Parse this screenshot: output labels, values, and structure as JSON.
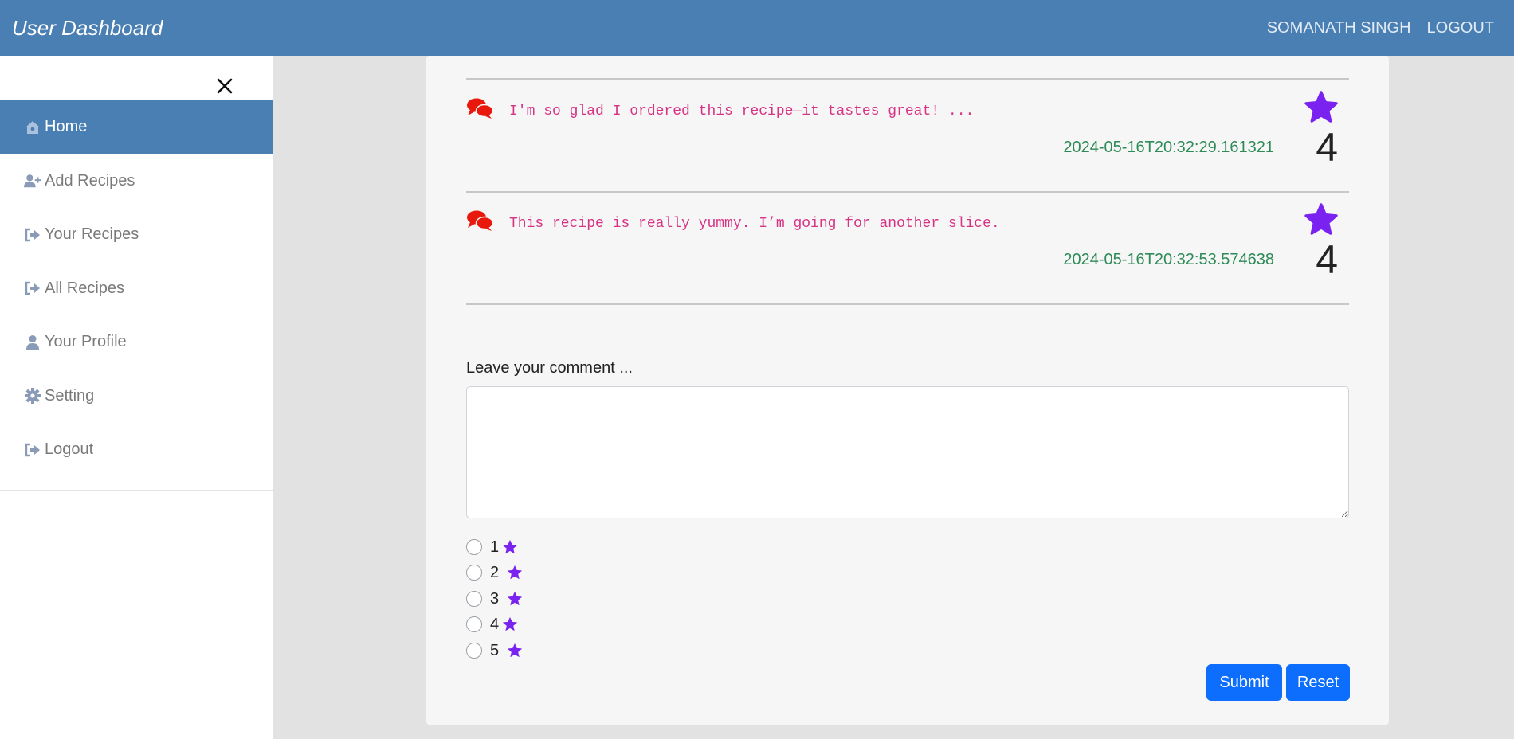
{
  "header": {
    "title": "User Dashboard",
    "user_name": "SOMANATH SINGH",
    "logout_label": "LOGOUT"
  },
  "sidebar": {
    "items": [
      {
        "label": "Home",
        "icon": "home-icon",
        "active": true
      },
      {
        "label": "Add Recipes",
        "icon": "add-user-icon",
        "active": false
      },
      {
        "label": "Your Recipes",
        "icon": "sign-out-icon",
        "active": false
      },
      {
        "label": "All Recipes",
        "icon": "sign-out-icon",
        "active": false
      },
      {
        "label": "Your Profile",
        "icon": "user-icon",
        "active": false
      },
      {
        "label": "Setting",
        "icon": "gear-icon",
        "active": false
      },
      {
        "label": "Logout",
        "icon": "sign-out-icon",
        "active": false
      }
    ]
  },
  "comments": [
    {
      "text": "I'm so glad I ordered this recipe—it tastes great! ...",
      "timestamp": "2024-05-16T20:32:29.161321",
      "rating": "4"
    },
    {
      "text": "This recipe is really yummy. I’m going for another slice.",
      "timestamp": "2024-05-16T20:32:53.574638",
      "rating": "4"
    }
  ],
  "form": {
    "label": "Leave your comment ...",
    "textarea_value": "",
    "rating_options": [
      "1",
      "2",
      "3",
      "4",
      "5"
    ],
    "submit_label": "Submit",
    "reset_label": "Reset"
  },
  "colors": {
    "topbar": "#4a7fb3",
    "star": "#7a22f0",
    "comment_icon": "#e8180c",
    "comment_text": "#d63384",
    "timestamp": "#2e8b57",
    "button": "#0d6efd"
  }
}
